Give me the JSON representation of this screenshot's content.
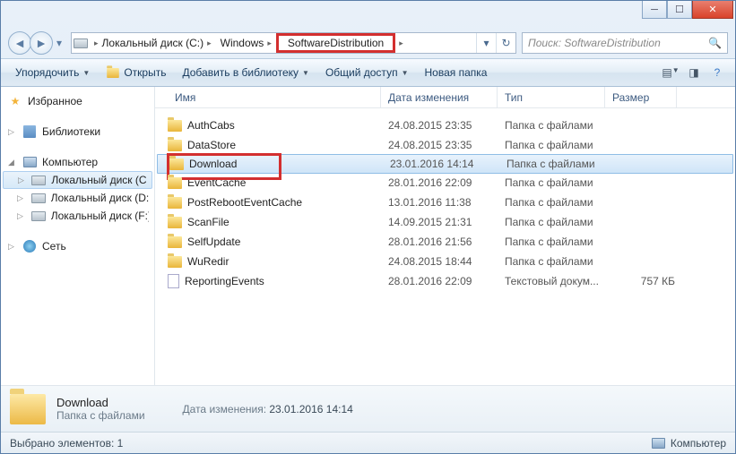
{
  "breadcrumb": {
    "items": [
      "Локальный диск (C:)",
      "Windows",
      "SoftwareDistribution"
    ]
  },
  "search": {
    "placeholder": "Поиск: SoftwareDistribution"
  },
  "toolbar": {
    "organize": "Упорядочить",
    "open": "Открыть",
    "addlib": "Добавить в библиотеку",
    "share": "Общий доступ",
    "newfolder": "Новая папка"
  },
  "columns": {
    "name": "Имя",
    "date": "Дата изменения",
    "type": "Тип",
    "size": "Размер"
  },
  "sidebar": {
    "favorites": "Избранное",
    "libraries": "Библиотеки",
    "computer": "Компьютер",
    "network": "Сеть",
    "drives": [
      "Локальный диск (C:)",
      "Локальный диск (D:)",
      "Локальный диск (F:)"
    ]
  },
  "files": [
    {
      "name": "AuthCabs",
      "date": "24.08.2015 23:35",
      "type": "Папка с файлами",
      "size": "",
      "icon": "folder"
    },
    {
      "name": "DataStore",
      "date": "24.08.2015 23:35",
      "type": "Папка с файлами",
      "size": "",
      "icon": "folder"
    },
    {
      "name": "Download",
      "date": "23.01.2016 14:14",
      "type": "Папка с файлами",
      "size": "",
      "icon": "folder",
      "selected": true,
      "highlight": true
    },
    {
      "name": "EventCache",
      "date": "28.01.2016 22:09",
      "type": "Папка с файлами",
      "size": "",
      "icon": "folder"
    },
    {
      "name": "PostRebootEventCache",
      "date": "13.01.2016 11:38",
      "type": "Папка с файлами",
      "size": "",
      "icon": "folder"
    },
    {
      "name": "ScanFile",
      "date": "14.09.2015 21:31",
      "type": "Папка с файлами",
      "size": "",
      "icon": "folder"
    },
    {
      "name": "SelfUpdate",
      "date": "28.01.2016 21:56",
      "type": "Папка с файлами",
      "size": "",
      "icon": "folder"
    },
    {
      "name": "WuRedir",
      "date": "24.08.2015 18:44",
      "type": "Папка с файлами",
      "size": "",
      "icon": "folder"
    },
    {
      "name": "ReportingEvents",
      "date": "28.01.2016 22:09",
      "type": "Текстовый докум...",
      "size": "757 КБ",
      "icon": "file"
    }
  ],
  "details": {
    "name": "Download",
    "type": "Папка с файлами",
    "date_label": "Дата изменения:",
    "date": "23.01.2016 14:14"
  },
  "status": {
    "selected": "Выбрано элементов: 1",
    "computer": "Компьютер"
  }
}
